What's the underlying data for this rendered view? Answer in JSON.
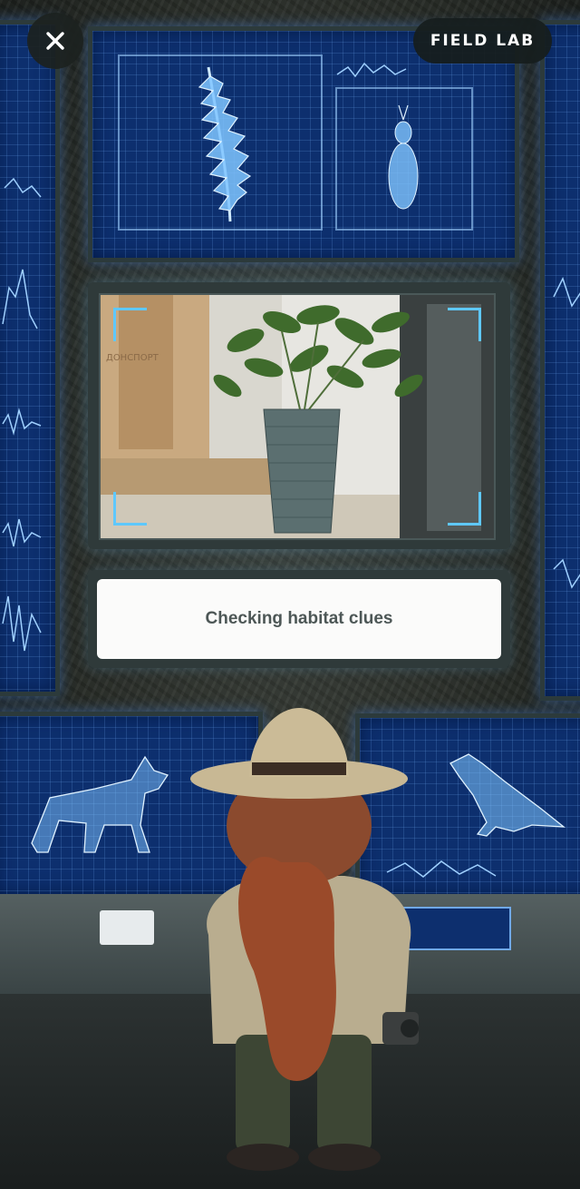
{
  "header": {
    "close_label": "",
    "badge_label": "FIELD LAB"
  },
  "camera": {
    "sign_text": "ДОНСПОРТ"
  },
  "status": {
    "message": "Checking habitat clues"
  },
  "colors": {
    "monitor_blue": "#0d2f6e",
    "hologram": "#9fd0ff",
    "bracket": "#5ec8ff",
    "panel_frame": "#2f3a3a",
    "card_bg": "#fbfbfa",
    "card_text": "#4d5756"
  },
  "icons": {
    "close": "close-icon",
    "fern": "fern-hologram-icon",
    "insect": "insect-hologram-icon",
    "wolf": "wolf-hologram-icon",
    "crow": "crow-hologram-icon"
  }
}
